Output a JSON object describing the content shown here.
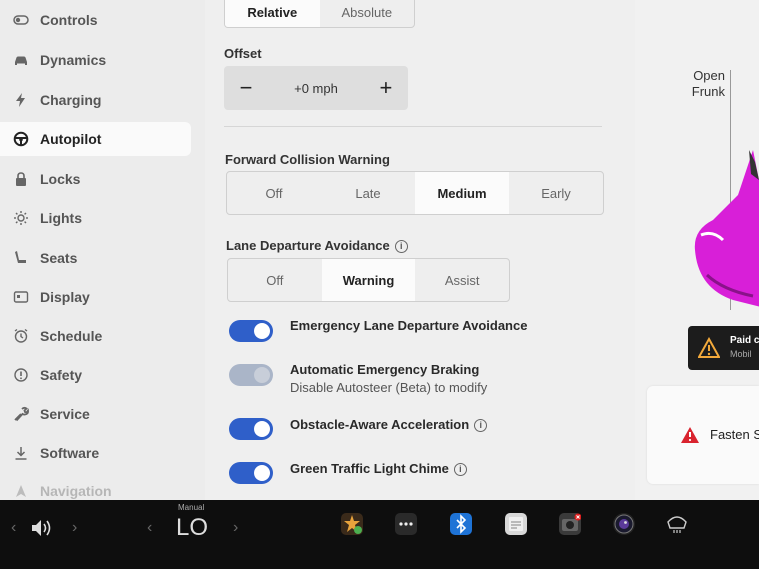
{
  "sidebar": {
    "items": [
      {
        "label": "Controls",
        "icon": "toggle-icon"
      },
      {
        "label": "Dynamics",
        "icon": "car-icon"
      },
      {
        "label": "Charging",
        "icon": "lightning-icon"
      },
      {
        "label": "Autopilot",
        "icon": "steering-wheel-icon"
      },
      {
        "label": "Locks",
        "icon": "lock-icon"
      },
      {
        "label": "Lights",
        "icon": "light-icon"
      },
      {
        "label": "Seats",
        "icon": "seat-icon"
      },
      {
        "label": "Display",
        "icon": "display-icon"
      },
      {
        "label": "Schedule",
        "icon": "clock-icon"
      },
      {
        "label": "Safety",
        "icon": "info-circle-icon"
      },
      {
        "label": "Service",
        "icon": "wrench-icon"
      },
      {
        "label": "Software",
        "icon": "download-icon"
      },
      {
        "label": "Navigation",
        "icon": "navigation-icon"
      }
    ],
    "active": "Autopilot"
  },
  "main": {
    "offset_mode": {
      "options": [
        "Relative",
        "Absolute"
      ],
      "selected": "Relative"
    },
    "offset": {
      "label": "Offset",
      "value": "+0 mph",
      "minus": "−",
      "plus": "+"
    },
    "fcw": {
      "label": "Forward Collision Warning",
      "options": [
        "Off",
        "Late",
        "Medium",
        "Early"
      ],
      "selected": "Medium"
    },
    "lda": {
      "label": "Lane Departure Avoidance",
      "info": "i",
      "options": [
        "Off",
        "Warning",
        "Assist"
      ],
      "selected": "Warning"
    },
    "toggles": [
      {
        "label": "Emergency Lane Departure Avoidance",
        "on": true
      },
      {
        "label": "Automatic Emergency Braking",
        "sub": "Disable Autosteer (Beta) to modify",
        "on": true,
        "disabled": true
      },
      {
        "label": "Obstacle-Aware Acceleration",
        "info": "i",
        "on": true
      },
      {
        "label": "Green Traffic Light Chime",
        "info": "i",
        "on": true
      }
    ]
  },
  "car_panel": {
    "frunk": "Open\nFrunk",
    "frunk_line1": "Open",
    "frunk_line2": "Frunk",
    "notice_title": "Paid c",
    "notice_sub": "Mobil",
    "alert": "Fasten S",
    "car_color": "#d81fd8"
  },
  "bottom_bar": {
    "climate_mode": "Manual",
    "temperature": "LO",
    "icons": [
      "volume-icon",
      "toybox-icon",
      "more-icon",
      "bluetooth-icon",
      "notes-icon",
      "dashcam-icon",
      "camera-app-icon",
      "rear-defrost-icon"
    ],
    "colors": {
      "accent": "#2f5fc9",
      "bluetooth": "#1e73d6",
      "background": "#0e0e0e"
    }
  }
}
